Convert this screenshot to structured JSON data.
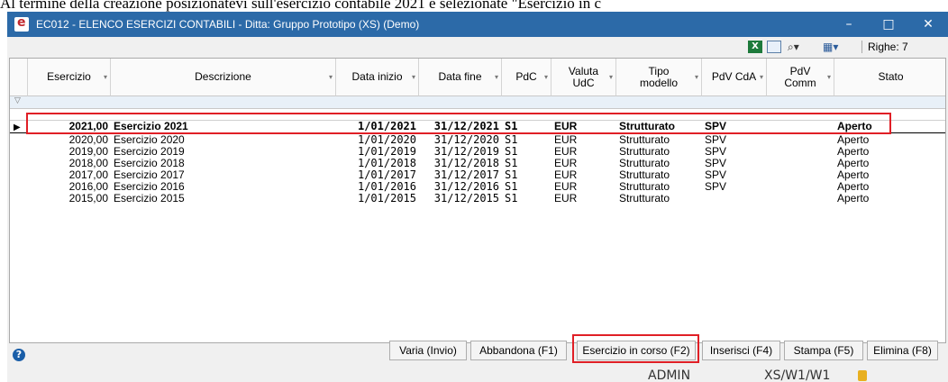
{
  "caption": "Al termine della creazione posizionatevi sull'esercizio contabile 2021 e selezionate \"Esercizio in c",
  "window": {
    "title": "EC012 - ELENCO ESERCIZI CONTABILI - Ditta: Gruppo Prototipo (XS) (Demo)",
    "minimize": "–",
    "maximize": "□",
    "close": "✕"
  },
  "toolbar": {
    "excel_icon": "excel-icon",
    "rows_label": "Righe: 7"
  },
  "grid": {
    "columns": [
      {
        "label": "Esercizio"
      },
      {
        "label": "Descrizione"
      },
      {
        "label": "Data inizio"
      },
      {
        "label": "Data fine"
      },
      {
        "label": "PdC"
      },
      {
        "label": "Valuta UdC"
      },
      {
        "label": "Tipo modello"
      },
      {
        "label": "PdV CdA"
      },
      {
        "label": "PdV Comm"
      },
      {
        "label": "Stato"
      }
    ],
    "rows": [
      {
        "esercizio": "2021,00",
        "descrizione": "Esercizio 2021",
        "data_inizio": "1/01/2021",
        "data_fine": "31/12/2021",
        "pdc": "S1",
        "valuta": "EUR",
        "tipo": "Strutturato",
        "pdv_cda": "SPV",
        "pdv_comm": "",
        "stato": "Aperto"
      },
      {
        "esercizio": "2020,00",
        "descrizione": "Esercizio 2020",
        "data_inizio": "1/01/2020",
        "data_fine": "31/12/2020",
        "pdc": "S1",
        "valuta": "EUR",
        "tipo": "Strutturato",
        "pdv_cda": "SPV",
        "pdv_comm": "",
        "stato": "Aperto"
      },
      {
        "esercizio": "2019,00",
        "descrizione": "Esercizio 2019",
        "data_inizio": "1/01/2019",
        "data_fine": "31/12/2019",
        "pdc": "S1",
        "valuta": "EUR",
        "tipo": "Strutturato",
        "pdv_cda": "SPV",
        "pdv_comm": "",
        "stato": "Aperto"
      },
      {
        "esercizio": "2018,00",
        "descrizione": "Esercizio 2018",
        "data_inizio": "1/01/2018",
        "data_fine": "31/12/2018",
        "pdc": "S1",
        "valuta": "EUR",
        "tipo": "Strutturato",
        "pdv_cda": "SPV",
        "pdv_comm": "",
        "stato": "Aperto"
      },
      {
        "esercizio": "2017,00",
        "descrizione": "Esercizio 2017",
        "data_inizio": "1/01/2017",
        "data_fine": "31/12/2017",
        "pdc": "S1",
        "valuta": "EUR",
        "tipo": "Strutturato",
        "pdv_cda": "SPV",
        "pdv_comm": "",
        "stato": "Aperto"
      },
      {
        "esercizio": "2016,00",
        "descrizione": "Esercizio 2016",
        "data_inizio": "1/01/2016",
        "data_fine": "31/12/2016",
        "pdc": "S1",
        "valuta": "EUR",
        "tipo": "Strutturato",
        "pdv_cda": "SPV",
        "pdv_comm": "",
        "stato": "Aperto"
      },
      {
        "esercizio": "2015,00",
        "descrizione": "Esercizio 2015",
        "data_inizio": "1/01/2015",
        "data_fine": "31/12/2015",
        "pdc": "S1",
        "valuta": "EUR",
        "tipo": "Strutturato",
        "pdv_cda": "",
        "pdv_comm": "",
        "stato": "Aperto"
      }
    ]
  },
  "buttons": {
    "varia": "Varia (Invio)",
    "abbandona": "Abbandona (F1)",
    "esercizio_in_corso": "Esercizio in corso (F2)",
    "inserisci": "Inserisci (F4)",
    "stampa": "Stampa (F5)",
    "elimina": "Elimina (F8)"
  },
  "status": {
    "user": "ADMIN",
    "db": "XS/W1/W1"
  },
  "colors": {
    "titlebar": "#2c6aa8",
    "highlight": "#e01f26"
  }
}
